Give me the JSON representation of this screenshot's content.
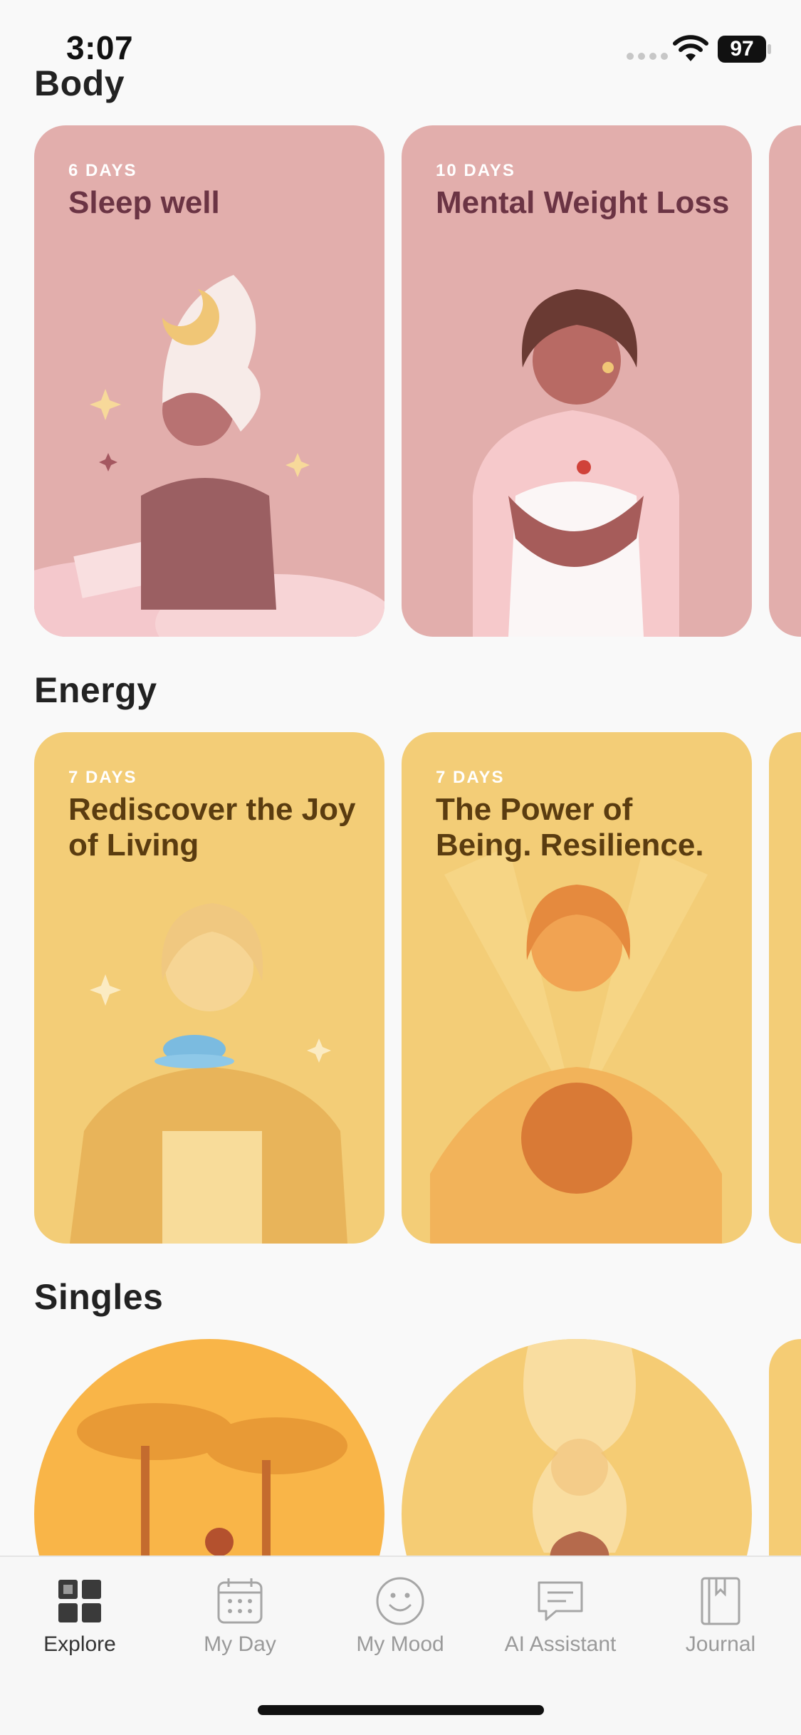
{
  "status_bar": {
    "time": "3:07",
    "battery": "97"
  },
  "sections": {
    "body": {
      "title": "Body",
      "cards": [
        {
          "days": "6 DAYS",
          "title": "Sleep well"
        },
        {
          "days": "10 DAYS",
          "title": "Mental Weight Loss"
        }
      ]
    },
    "energy": {
      "title": "Energy",
      "cards": [
        {
          "days": "7 DAYS",
          "title": "Rediscover the Joy of Living"
        },
        {
          "days": "7 DAYS",
          "title": "The Power of Being. Resilience."
        }
      ]
    },
    "singles": {
      "title": "Singles"
    }
  },
  "tabs": [
    {
      "label": "Explore",
      "icon": "grid-icon",
      "active": true
    },
    {
      "label": "My Day",
      "icon": "calendar-icon",
      "active": false
    },
    {
      "label": "My Mood",
      "icon": "smiley-icon",
      "active": false
    },
    {
      "label": "AI Assistant",
      "icon": "chat-icon",
      "active": false
    },
    {
      "label": "Journal",
      "icon": "journal-icon",
      "active": false
    }
  ],
  "colors": {
    "body_card": "#e2aeac",
    "energy_card": "#f3cd77",
    "tab_active": "#333333",
    "tab_inactive": "#9a9a9a"
  }
}
